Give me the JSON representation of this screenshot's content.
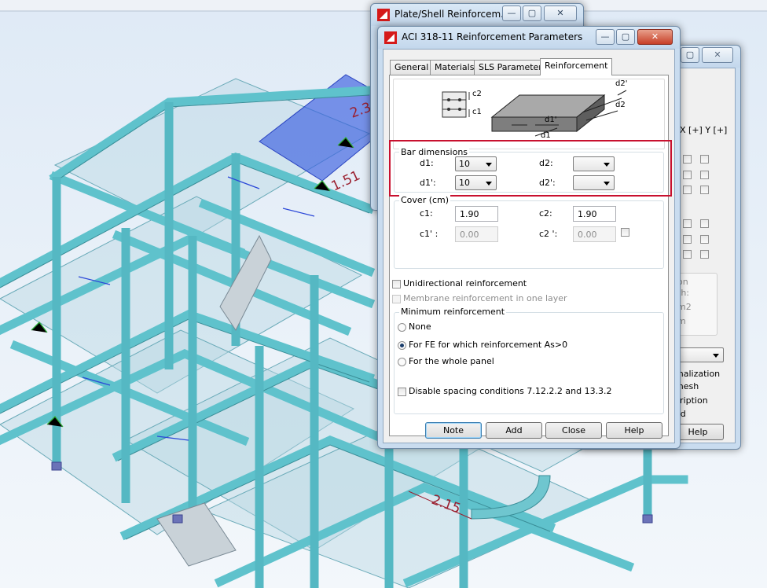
{
  "background_window": {
    "header_axes": "X [+] Y [+]",
    "texts": [
      "on",
      "th:",
      "m2",
      "m"
    ],
    "options": [
      "malization",
      "mesh",
      "cription",
      "ed"
    ],
    "help_label": "Help"
  },
  "viewport": {
    "dim_labels": [
      "2.30",
      "1.51",
      "2.15"
    ]
  },
  "plate_window": {
    "title": "Plate/Shell Reinforcem..."
  },
  "dialog": {
    "title": "ACI 318-11 Reinforcement Parameters",
    "tabs": [
      {
        "label": "General"
      },
      {
        "label": "Materials"
      },
      {
        "label": "SLS Parameters"
      },
      {
        "label": "Reinforcement"
      }
    ],
    "diagram_labels": {
      "c2": "c2",
      "c1": "c1",
      "d2_prime": "d2'",
      "d2": "d2",
      "d1_prime": "d1'",
      "d1": "d1"
    },
    "bar_dimensions": {
      "title": "Bar dimensions",
      "d1_label": "d1:",
      "d1_value": "10",
      "d2_label": "d2:",
      "d2_value": "",
      "d1p_label": "d1':",
      "d1p_value": "10",
      "d2p_label": "d2':",
      "d2p_value": ""
    },
    "cover": {
      "title": "Cover (cm)",
      "c1_label": "c1:",
      "c1_value": "1.90",
      "c2_label": "c2:",
      "c2_value": "1.90",
      "c1p_label": "c1' :",
      "c1p_value": "0.00",
      "c2p_label": "c2 ':",
      "c2p_value": "0.00"
    },
    "unidirectional_label": "Unidirectional reinforcement",
    "membrane_label": "Membrane reinforcement in one layer",
    "minimum": {
      "title": "Minimum reinforcement",
      "none_label": "None",
      "fe_label": "For FE for which reinforcement As>0",
      "panel_label": "For the whole panel"
    },
    "disable_spacing_label": "Disable spacing conditions 7.12.2.2 and 13.3.2",
    "buttons": {
      "note": "Note",
      "add": "Add",
      "close": "Close",
      "help": "Help"
    },
    "highlight_color": "#c8102e"
  }
}
